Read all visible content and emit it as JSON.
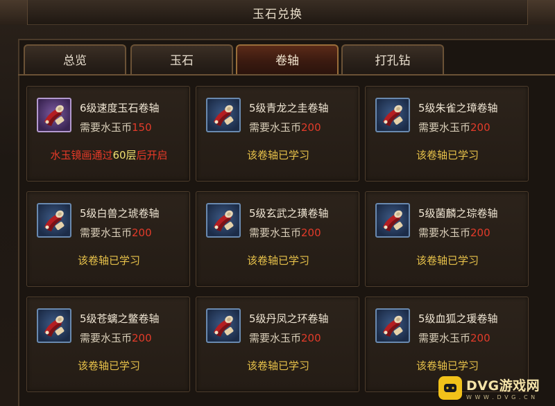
{
  "window": {
    "title": "玉石兑换"
  },
  "tabs": [
    {
      "label": "总览",
      "active": false
    },
    {
      "label": "玉石",
      "active": false
    },
    {
      "label": "卷轴",
      "active": true
    },
    {
      "label": "打孔钻",
      "active": false
    }
  ],
  "cards": [
    {
      "name": "6级速度玉石卷轴",
      "cost_prefix": "需要水玉币",
      "cost_value": "150",
      "icon": "purple-scroll-icon",
      "locked": true,
      "status_a": "水玉镜画通过",
      "status_num": "60层",
      "status_b": "后开启"
    },
    {
      "name": "5级青龙之圭卷轴",
      "cost_prefix": "需要水玉币",
      "cost_value": "200",
      "icon": "blue-scroll-icon",
      "locked": false,
      "status": "该卷轴已学习"
    },
    {
      "name": "5级朱雀之璋卷轴",
      "cost_prefix": "需要水玉币",
      "cost_value": "200",
      "icon": "blue-scroll-icon",
      "locked": false,
      "status": "该卷轴已学习"
    },
    {
      "name": "5级白兽之琥卷轴",
      "cost_prefix": "需要水玉币",
      "cost_value": "200",
      "icon": "blue-scroll-icon",
      "locked": false,
      "status": "该卷轴已学习"
    },
    {
      "name": "5级玄武之璜卷轴",
      "cost_prefix": "需要水玉币",
      "cost_value": "200",
      "icon": "blue-scroll-icon",
      "locked": false,
      "status": "该卷轴已学习"
    },
    {
      "name": "5级菌麟之琮卷轴",
      "cost_prefix": "需要水玉币",
      "cost_value": "200",
      "icon": "blue-scroll-icon",
      "locked": false,
      "status": "该卷轴已学习"
    },
    {
      "name": "5级苍螭之鳖卷轴",
      "cost_prefix": "需要水玉币",
      "cost_value": "200",
      "icon": "blue-scroll-icon",
      "locked": false,
      "status": "该卷轴已学习"
    },
    {
      "name": "5级丹凤之环卷轴",
      "cost_prefix": "需要水玉币",
      "cost_value": "200",
      "icon": "blue-scroll-icon",
      "locked": false,
      "status": "该卷轴已学习"
    },
    {
      "name": "5级血狐之瑗卷轴",
      "cost_prefix": "需要水玉币",
      "cost_value": "200",
      "icon": "blue-scroll-icon",
      "locked": false,
      "status": "该卷轴已学习"
    }
  ],
  "watermark": {
    "brand": "DVG游戏网",
    "sub": "W W W . D V G . C N"
  },
  "colors": {
    "cost_number": "#e23b2a",
    "learned": "#e8c24a",
    "locked": "#e83a28",
    "active_tab": "#5a2a18"
  }
}
